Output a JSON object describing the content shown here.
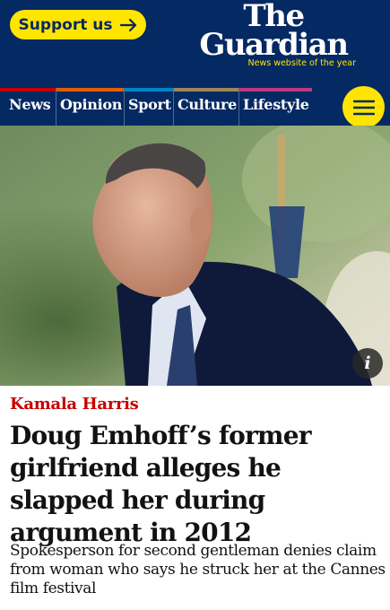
{
  "header": {
    "support_label": "Support us",
    "support_icon": "arrow-right-icon",
    "logo_line1": "The",
    "logo_line2": "Guardian",
    "tagline": "News website of the year",
    "brand_color": "#052962",
    "accent_color": "#ffe500"
  },
  "nav": {
    "items": [
      {
        "label": "News",
        "color": "#c70000"
      },
      {
        "label": "Opinion",
        "color": "#e05e00"
      },
      {
        "label": "Sport",
        "color": "#0084c6"
      },
      {
        "label": "Culture",
        "color": "#a1845c"
      },
      {
        "label": "Lifestyle",
        "color": "#bb3b80"
      }
    ],
    "menu_icon": "hamburger-menu-icon"
  },
  "hero": {
    "image": "photo of a man in a dark suit and tie outdoors",
    "info_label": "i",
    "info_icon": "info-icon"
  },
  "article": {
    "kicker": "Kamala Harris",
    "kicker_color": "#c70000",
    "headline": "Doug Emhoff’s former girlfriend alleges he slapped her during argument in 2012",
    "standfirst": "Spokesperson for second gentleman denies claim from woman who says he struck her at the Cannes film festival"
  }
}
